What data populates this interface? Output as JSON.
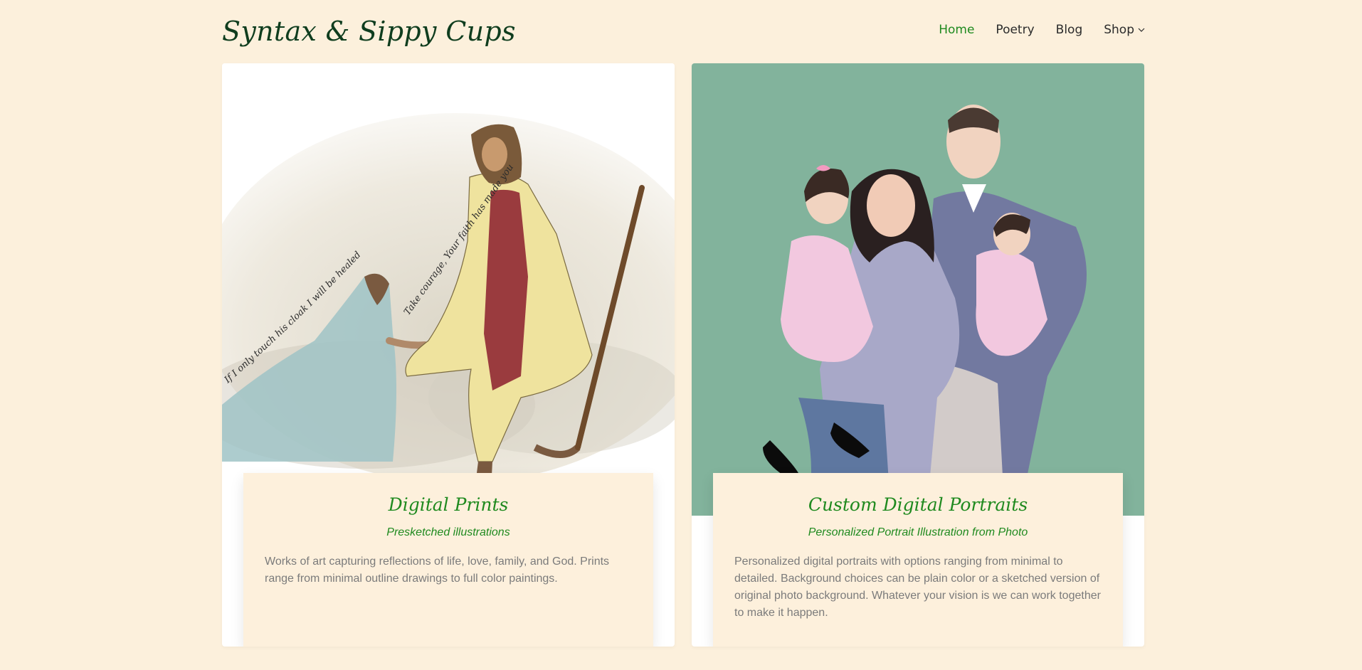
{
  "site": {
    "title": "Syntax & Sippy Cups"
  },
  "nav": {
    "items": [
      {
        "label": "Home",
        "active": true
      },
      {
        "label": "Poetry"
      },
      {
        "label": "Blog"
      },
      {
        "label": "Shop",
        "has_dropdown": true
      }
    ]
  },
  "cards": [
    {
      "title": "Digital Prints",
      "subtitle": "Presketched illustrations",
      "description": "Works of art capturing reflections of life, love, family, and God. Prints range from minimal outline drawings to full color paintings.",
      "image_text": {
        "left_quote": "If I only touch his cloak I will be healed",
        "right_quote": "Take courage, Your faith has made you well"
      }
    },
    {
      "title": "Custom Digital Portraits",
      "subtitle": "Personalized Portrait Illustration from Photo",
      "description": "Personalized digital portraits with options ranging from minimal to detailed. Background choices can be plain color or a sketched version of original photo background. Whatever your vision is we can work together to make it happen."
    }
  ],
  "colors": {
    "page_bg": "#fcf0dc",
    "accent_green": "#1f8a1f",
    "logo_green": "#0f3d1e",
    "portrait_bg": "#82b39c"
  }
}
